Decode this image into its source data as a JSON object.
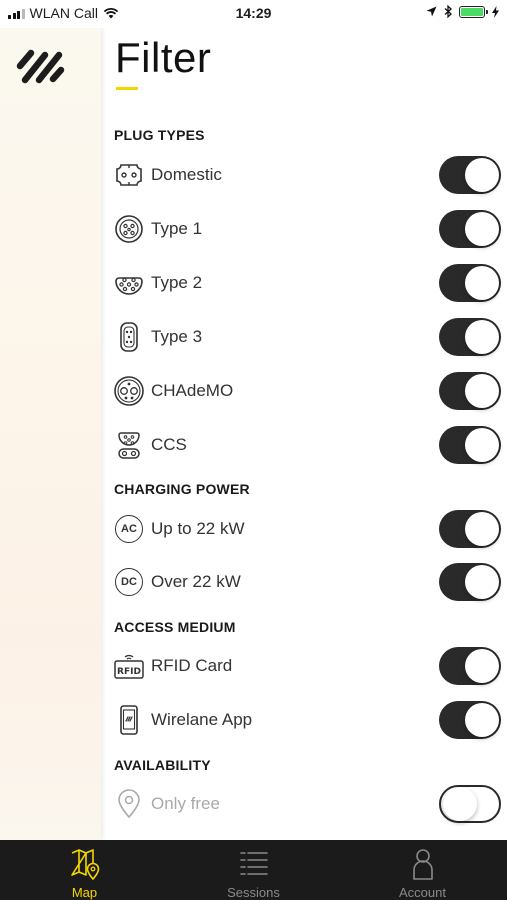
{
  "status_bar": {
    "carrier": "WLAN Call",
    "time": "14:29",
    "battery_color": "#4cd964"
  },
  "header": {
    "title": "Filter",
    "accent_color": "#f5d600"
  },
  "sections": {
    "plug_types": {
      "title": "PLUG TYPES",
      "items": [
        {
          "label": "Domestic",
          "icon": "domestic-plug-icon",
          "enabled": true
        },
        {
          "label": "Type 1",
          "icon": "type1-plug-icon",
          "enabled": true
        },
        {
          "label": "Type 2",
          "icon": "type2-plug-icon",
          "enabled": true
        },
        {
          "label": "Type 3",
          "icon": "type3-plug-icon",
          "enabled": true
        },
        {
          "label": "CHAdeMO",
          "icon": "chademo-plug-icon",
          "enabled": true
        },
        {
          "label": "CCS",
          "icon": "ccs-plug-icon",
          "enabled": true
        }
      ]
    },
    "charging_power": {
      "title": "CHARGING POWER",
      "items": [
        {
          "label": "Up to 22 kW",
          "icon": "ac-icon",
          "badge": "AC",
          "enabled": true
        },
        {
          "label": "Over 22 kW",
          "icon": "dc-icon",
          "badge": "DC",
          "enabled": true
        }
      ]
    },
    "access_medium": {
      "title": "ACCESS MEDIUM",
      "items": [
        {
          "label": "RFID Card",
          "icon": "rfid-card-icon",
          "enabled": true
        },
        {
          "label": "Wirelane App",
          "icon": "phone-app-icon",
          "enabled": true
        }
      ]
    },
    "availability": {
      "title": "AVAILABILITY",
      "items": [
        {
          "label": "Only free",
          "icon": "location-pin-icon",
          "enabled": false
        }
      ]
    }
  },
  "tab_bar": {
    "tabs": [
      {
        "label": "Map",
        "icon": "map-icon",
        "active": true
      },
      {
        "label": "Sessions",
        "icon": "sessions-list-icon",
        "active": false
      },
      {
        "label": "Account",
        "icon": "person-icon",
        "active": false
      }
    ]
  }
}
